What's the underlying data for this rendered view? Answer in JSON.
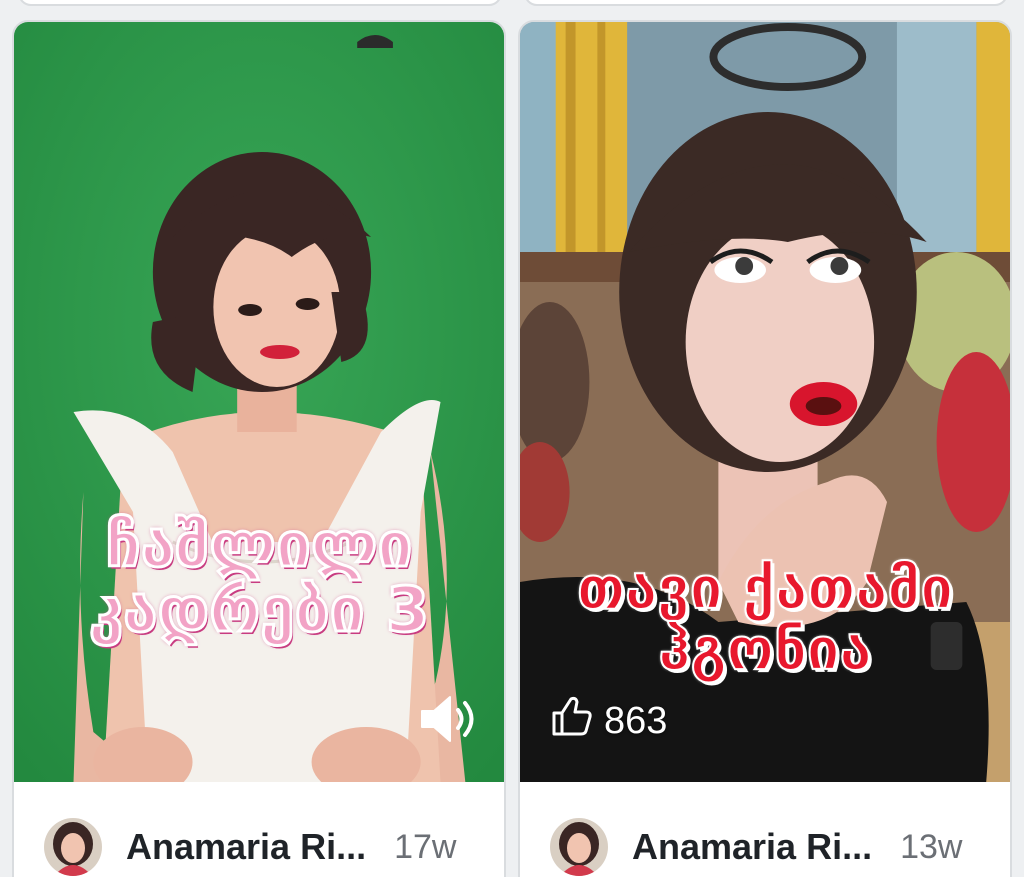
{
  "posts": [
    {
      "overlay_title_line1": "ჩაშლილი",
      "overlay_title_line2": "კადრები 3",
      "sound_icon": "speaker-on-icon",
      "author": "Anamaria Ri...",
      "age": "17w"
    },
    {
      "overlay_title_line1": "თავი ქათამი",
      "overlay_title_line2": "ჰგონია",
      "like_icon": "thumbs-up-icon",
      "likes": "863",
      "author": "Anamaria Ri...",
      "age": "13w"
    }
  ],
  "colors": {
    "left_background": "#2e9a4c",
    "left_title": "#f2a3c6",
    "right_title": "#e8182d",
    "text_dark": "#1f2328",
    "text_muted": "#6b6f75"
  }
}
